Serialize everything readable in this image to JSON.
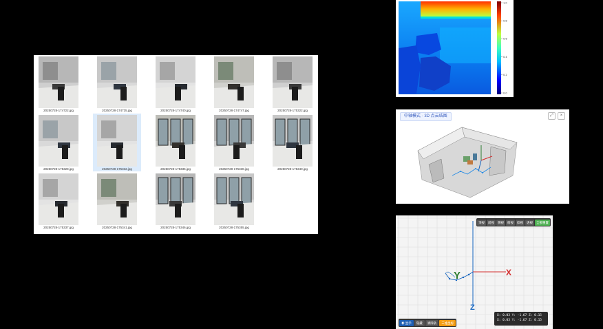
{
  "file_grid": {
    "files": [
      "20250728-174722.jpg",
      "20250728-174735.jpg",
      "20250728-174740.jpg",
      "20250728-174747.jpg",
      "20250728-175322.jpg",
      "20250728-175328.jpg",
      "20250728-175332.jpg",
      "20250728-175336.jpg",
      "20250728-175338.jpg",
      "20250728-175340.jpg",
      "20250728-175337.jpg",
      "20250728-175341.jpg",
      "20250728-175346.jpg",
      "20250728-175355.jpg"
    ],
    "selected_index": 6
  },
  "depth_map": {
    "colorbar_ticks": [
      "1.0",
      "0.8",
      "0.6",
      "0.4",
      "0.2",
      "0.0"
    ],
    "colormap": "jet"
  },
  "point_cloud": {
    "tag_label": "中轴模式 · 3D 点云结图",
    "tools": [
      "expand-icon",
      "close-icon"
    ]
  },
  "trajectory": {
    "toolbar": [
      "顶视",
      "前视",
      "侧视",
      "俯视",
      "仰视",
      "透视",
      "全部重置"
    ],
    "bottom_buttons": [
      "◉ 显示",
      "隐藏",
      "清除轨",
      "三维坐标"
    ],
    "axis_labels": {
      "x": "X",
      "y": "Y",
      "z": "Z"
    },
    "colors": {
      "x": "#d32f2f",
      "y": "#2e7d32",
      "z": "#1565c0"
    },
    "coord_lines": [
      "X: 0.03  Y: -1.67  Z: 0.15",
      "X: 0.03  Y: -1.67  Z: 0.15"
    ]
  }
}
